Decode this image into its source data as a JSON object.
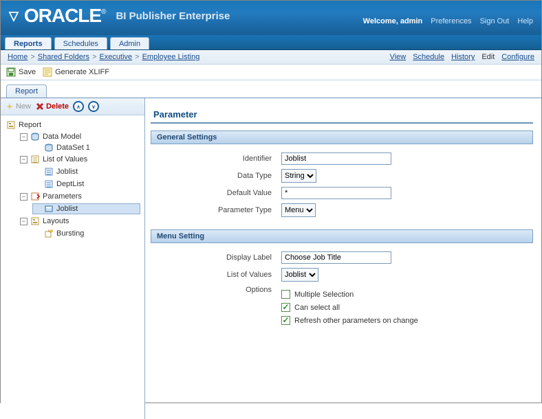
{
  "header": {
    "brand_word": "ORACLE",
    "brand_suffix": "BI Publisher Enterprise",
    "welcome": "Welcome, admin",
    "links": {
      "preferences": "Preferences",
      "signout": "Sign Out",
      "help": "Help"
    }
  },
  "tabs": [
    {
      "id": "reports",
      "label": "Reports",
      "active": true
    },
    {
      "id": "schedules",
      "label": "Schedules",
      "active": false
    },
    {
      "id": "admin",
      "label": "Admin",
      "active": false
    }
  ],
  "breadcrumb": {
    "items": [
      "Home",
      "Shared Folders",
      "Executive",
      "Employee Listing"
    ],
    "right_links": {
      "view": "View",
      "schedule": "Schedule",
      "history": "History",
      "edit": "Edit",
      "configure": "Configure"
    }
  },
  "toolbar": {
    "save": "Save",
    "generate_xliff": "Generate XLIFF"
  },
  "subtab": {
    "report": "Report"
  },
  "left_toolbar": {
    "new": "New",
    "delete": "Delete"
  },
  "tree": {
    "root": "Report",
    "data_model": {
      "label": "Data Model",
      "children": [
        "DataSet 1"
      ]
    },
    "lov": {
      "label": "List of Values",
      "children": [
        "Joblist",
        "DeptList"
      ]
    },
    "parameters": {
      "label": "Parameters",
      "children": [
        "Joblist"
      ],
      "selected": "Joblist"
    },
    "layouts": {
      "label": "Layouts",
      "children": [
        "Bursting"
      ]
    }
  },
  "content": {
    "title": "Parameter",
    "general": {
      "bar": "General Settings",
      "labels": {
        "identifier": "Identifier",
        "data_type": "Data Type",
        "default_value": "Default Value",
        "param_type": "Parameter Type"
      },
      "values": {
        "identifier": "Joblist",
        "data_type_selected": "String",
        "default_value": "*",
        "param_type_selected": "Menu"
      }
    },
    "menu": {
      "bar": "Menu Setting",
      "labels": {
        "display_label": "Display Label",
        "lov": "List of Values",
        "options": "Options"
      },
      "values": {
        "display_label": "Choose Job Title",
        "lov_selected": "Joblist"
      },
      "options": {
        "multi": {
          "label": "Multiple Selection",
          "checked": false
        },
        "all": {
          "label": "Can select all",
          "checked": true
        },
        "refresh": {
          "label": "Refresh other parameters on change",
          "checked": true
        }
      }
    }
  }
}
